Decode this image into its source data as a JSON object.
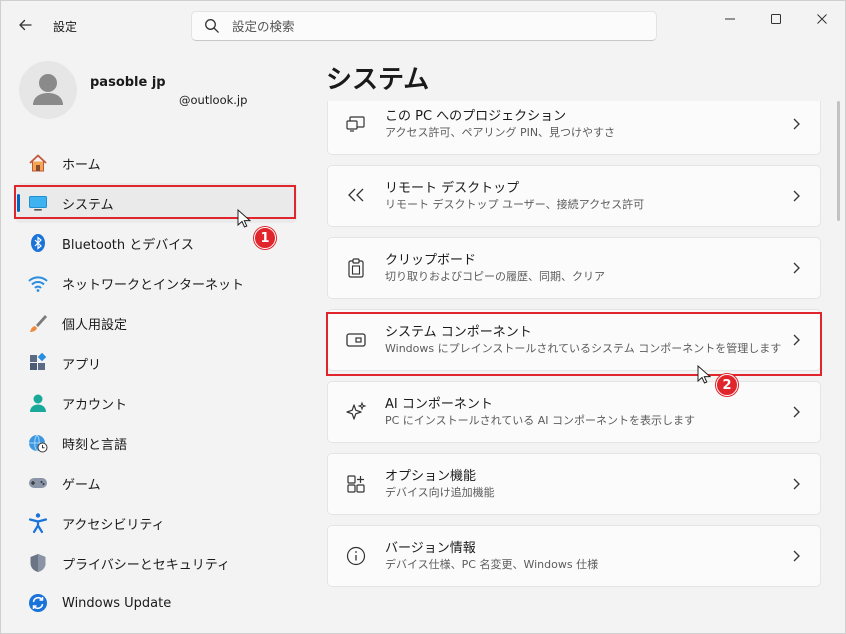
{
  "titlebar": {
    "app_title": "設定",
    "search_placeholder": "設定の検索"
  },
  "profile": {
    "name": "pasoble jp",
    "email": "@outlook.jp"
  },
  "sidebar": {
    "items": [
      {
        "label": "ホーム",
        "icon": "home-icon"
      },
      {
        "label": "システム",
        "icon": "system-monitor-icon",
        "selected": true
      },
      {
        "label": "Bluetooth とデバイス",
        "icon": "bluetooth-icon"
      },
      {
        "label": "ネットワークとインターネット",
        "icon": "wifi-icon"
      },
      {
        "label": "個人用設定",
        "icon": "brush-icon"
      },
      {
        "label": "アプリ",
        "icon": "apps-icon"
      },
      {
        "label": "アカウント",
        "icon": "account-icon"
      },
      {
        "label": "時刻と言語",
        "icon": "globe-clock-icon"
      },
      {
        "label": "ゲーム",
        "icon": "gamepad-icon"
      },
      {
        "label": "アクセシビリティ",
        "icon": "accessibility-icon"
      },
      {
        "label": "プライバシーとセキュリティ",
        "icon": "shield-icon"
      },
      {
        "label": "Windows Update",
        "icon": "update-icon"
      }
    ]
  },
  "main": {
    "page_title": "システム",
    "cards": [
      {
        "title": "この PC へのプロジェクション",
        "subtitle": "アクセス許可、ペアリング PIN、見つけやすさ",
        "icon": "projection-icon"
      },
      {
        "title": "リモート デスクトップ",
        "subtitle": "リモート デスクトップ ユーザー、接続アクセス許可",
        "icon": "remote-desktop-icon"
      },
      {
        "title": "クリップボード",
        "subtitle": "切り取りおよびコピーの履歴、同期、クリア",
        "icon": "clipboard-icon"
      },
      {
        "title": "システム コンポーネント",
        "subtitle": "Windows にプレインストールされているシステム コンポーネントを管理します",
        "icon": "system-components-icon"
      },
      {
        "title": "AI コンポーネント",
        "subtitle": "PC にインストールされている AI コンポーネントを表示します",
        "icon": "sparkle-icon"
      },
      {
        "title": "オプション機能",
        "subtitle": "デバイス向け追加機能",
        "icon": "optional-features-icon"
      },
      {
        "title": "バージョン情報",
        "subtitle": "デバイス仕様、PC 名変更、Windows 仕様",
        "icon": "info-icon"
      }
    ]
  },
  "annotations": {
    "badge_1": "1",
    "badge_2": "2"
  },
  "colors": {
    "accent": "#0067c0",
    "highlight": "#e0262c"
  }
}
